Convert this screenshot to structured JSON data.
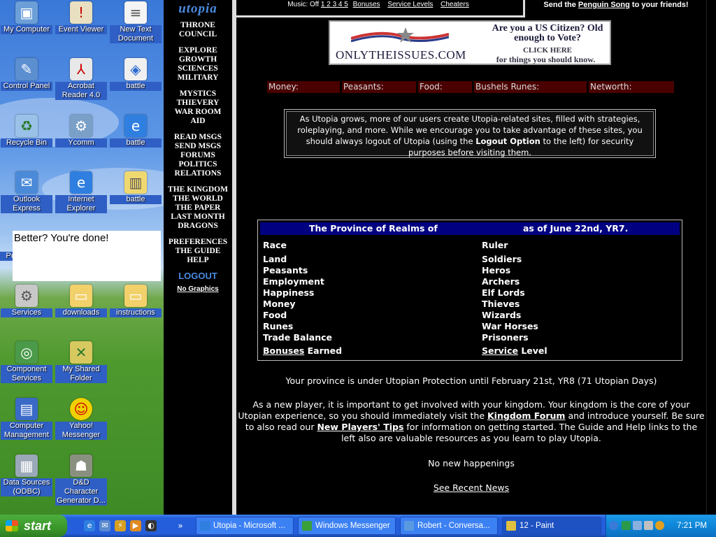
{
  "desktop": {
    "icons": [
      {
        "label": "My Computer",
        "sel": true
      },
      {
        "label": "Event Viewer",
        "sel": true
      },
      {
        "label": "New Text Document",
        "sel": true
      },
      {
        "label": "Control Panel",
        "sel": true
      },
      {
        "label": "Acrobat Reader 4.0",
        "sel": false
      },
      {
        "label": "battle",
        "sel": false
      },
      {
        "label": "Recycle Bin",
        "sel": false
      },
      {
        "label": "Ycomm",
        "sel": false
      },
      {
        "label": "battle",
        "sel": false
      },
      {
        "label": "Outlook Express",
        "sel": true
      },
      {
        "label": "Internet Explorer",
        "sel": true
      },
      {
        "label": "battle",
        "sel": false
      },
      {
        "label": "Services",
        "sel": true
      },
      {
        "label": "downloads",
        "sel": true
      },
      {
        "label": "instructions",
        "sel": true
      },
      {
        "label": "Component Services",
        "sel": true
      },
      {
        "label": "My Shared Folder",
        "sel": true
      },
      {
        "label": "Computer Management",
        "sel": true
      },
      {
        "label": "Yahoo! Messenger",
        "sel": true
      },
      {
        "label": "Data Sources (ODBC)",
        "sel": true
      },
      {
        "label": "D&D Character Generator D...",
        "sel": true
      }
    ],
    "partial_label": "Pe",
    "tooltip": "Better? You're done!"
  },
  "nav": {
    "logo": "utopia",
    "groups": [
      [
        "THRONE",
        "COUNCIL"
      ],
      [
        "EXPLORE",
        "GROWTH",
        "SCIENCES",
        "MILITARY"
      ],
      [
        "MYSTICS",
        "THIEVERY",
        "WAR ROOM",
        "AID"
      ],
      [
        "READ MSGS",
        "SEND MSGS",
        "FORUMS",
        "POLITICS",
        "RELATIONS"
      ],
      [
        "THE KINGDOM",
        "THE WORLD",
        "THE PAPER",
        "LAST MONTH",
        "DRAGONS"
      ],
      [
        "PREFERENCES",
        "THE GUIDE",
        "HELP"
      ]
    ],
    "logout": "LOGOUT",
    "no_graphics": "No Graphics"
  },
  "topbar": {
    "music": "Music: Off",
    "pages": "1 2 3 4 5",
    "bonuses": "Bonuses",
    "service_levels": "Service Levels",
    "cheaters": "Cheaters",
    "penguin_pre": "Send the",
    "penguin_link": "Penguin Song",
    "penguin_post": "to your friends!"
  },
  "ad": {
    "site": "ONLYTHEISSUES.COM",
    "question": "Are you a US Citizen? Old enough to Vote?",
    "click": "CLICK HERE",
    "things": "for things you should know."
  },
  "stats": {
    "money": "Money:",
    "peasants": "Peasants:",
    "food": "Food:",
    "runes": "Bushels Runes:",
    "networth": "Networth:"
  },
  "notice": {
    "pre": "As Utopia grows, more of our users create Utopia-related sites, filled with strategies, roleplaying, and more. While we encourage you to take advantage of these sites, you should always logout of Utopia (using the",
    "bold": "Logout Option",
    "post": "to the left) for security purposes before visiting them."
  },
  "province": {
    "title": "The Province of Realms of",
    "date": "as of June 22nd, YR7.",
    "left": [
      "Race",
      "Land",
      "Peasants",
      "Employment",
      "Happiness",
      "Money",
      "Food",
      "Runes",
      "Trade Balance"
    ],
    "right": [
      "Ruler",
      "Soldiers",
      "Heros",
      "Archers",
      "Elf Lords",
      "Thieves",
      "Wizards",
      "War Horses",
      "Prisoners"
    ],
    "bonuses_link": "Bonuses",
    "bonuses_rest": "Earned",
    "service_link": "Service",
    "service_rest": "Level"
  },
  "protection": "Your province is under Utopian Protection until February 21st, YR8 (71 Utopian Days)",
  "newplayer": {
    "p1": "As a new player, it is important to get involved with your kingdom. Your kingdom is the core of your Utopian experience, so you should immediately visit the",
    "link1": "Kingdom Forum",
    "p2": "and introduce yourself. Be sure to also read our",
    "link2": "New Players' Tips",
    "p3": "for information on getting started. The Guide and Help links to the left also are valuable resources as you learn to play Utopia."
  },
  "happenings": "No new happenings",
  "recent_news": "See Recent News",
  "taskbar": {
    "start": "start",
    "items": [
      "Utopia - Microsoft ...",
      "Windows Messenger",
      "Robert - Conversa...",
      "12 - Paint"
    ],
    "clock": "7:21 PM"
  }
}
